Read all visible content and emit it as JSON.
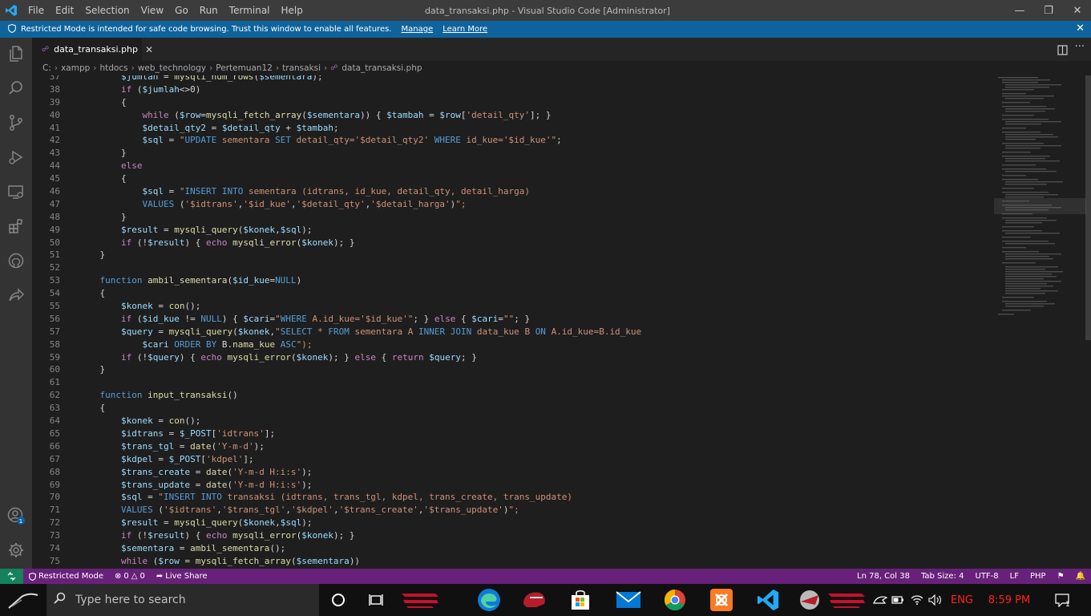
{
  "titlebar": {
    "menu": [
      "File",
      "Edit",
      "Selection",
      "View",
      "Go",
      "Run",
      "Terminal",
      "Help"
    ],
    "title": "data_transaksi.php - Visual Studio Code [Administrator]"
  },
  "banner": {
    "message": "Restricted Mode is intended for safe code browsing. Trust this window to enable all features.",
    "manage": "Manage",
    "learn_more": "Learn More"
  },
  "tab": {
    "label": "data_transaksi.php"
  },
  "breadcrumbs": [
    "C:",
    "xampp",
    "htdocs",
    "web_technology",
    "Pertemuan12",
    "transaksi",
    "data_transaksi.php"
  ],
  "code": {
    "lines": [
      {
        "n": "37",
        "t": "        $jumlah = mysqli_num_rows($sementara);"
      },
      {
        "n": "38",
        "t": "        if ($jumlah<>0)"
      },
      {
        "n": "39",
        "t": "        {"
      },
      {
        "n": "40",
        "t": "            while ($row=mysqli_fetch_array($sementara)) { $tambah = $row['detail_qty']; }"
      },
      {
        "n": "41",
        "t": "            $detail_qty2 = $detail_qty + $tambah;"
      },
      {
        "n": "42",
        "t": "            $sql = \"UPDATE sementara SET detail_qty='$detail_qty2' WHERE id_kue='$id_kue'\";"
      },
      {
        "n": "43",
        "t": "        }"
      },
      {
        "n": "44",
        "t": "        else"
      },
      {
        "n": "45",
        "t": "        {"
      },
      {
        "n": "46",
        "t": "            $sql = \"INSERT INTO sementara (idtrans, id_kue, detail_qty, detail_harga)"
      },
      {
        "n": "47",
        "t": "            VALUES ('$idtrans','$id_kue','$detail_qty','$detail_harga')\";"
      },
      {
        "n": "48",
        "t": "        }"
      },
      {
        "n": "49",
        "t": "        $result = mysqli_query($konek,$sql);"
      },
      {
        "n": "50",
        "t": "        if (!$result) { echo mysqli_error($konek); }"
      },
      {
        "n": "51",
        "t": "    }"
      },
      {
        "n": "52",
        "t": ""
      },
      {
        "n": "53",
        "t": "    function ambil_sementara($id_kue=NULL)"
      },
      {
        "n": "54",
        "t": "    {"
      },
      {
        "n": "55",
        "t": "        $konek = con();"
      },
      {
        "n": "56",
        "t": "        if ($id_kue != NULL) { $cari=\"WHERE A.id_kue='$id_kue'\"; } else { $cari=\"\"; }"
      },
      {
        "n": "57",
        "t": "        $query = mysqli_query($konek,\"SELECT * FROM sementara A INNER JOIN data_kue B ON A.id_kue=B.id_kue"
      },
      {
        "n": "58",
        "t": "            $cari ORDER BY B.nama_kue ASC\");"
      },
      {
        "n": "59",
        "t": "        if (!$query) { echo mysqli_error($konek); } else { return $query; }"
      },
      {
        "n": "60",
        "t": "    }"
      },
      {
        "n": "61",
        "t": ""
      },
      {
        "n": "62",
        "t": "    function input_transaksi()"
      },
      {
        "n": "63",
        "t": "    {"
      },
      {
        "n": "64",
        "t": "        $konek = con();"
      },
      {
        "n": "65",
        "t": "        $idtrans = $_POST['idtrans'];"
      },
      {
        "n": "66",
        "t": "        $trans_tgl = date('Y-m-d');"
      },
      {
        "n": "67",
        "t": "        $kdpel = $_POST['kdpel'];"
      },
      {
        "n": "68",
        "t": "        $trans_create = date('Y-m-d H:i:s');"
      },
      {
        "n": "69",
        "t": "        $trans_update = date('Y-m-d H:i:s');"
      },
      {
        "n": "70",
        "t": "        $sql = \"INSERT INTO transaksi (idtrans, trans_tgl, kdpel, trans_create, trans_update)"
      },
      {
        "n": "71",
        "t": "        VALUES ('$idtrans','$trans_tgl','$kdpel','$trans_create','$trans_update')\";"
      },
      {
        "n": "72",
        "t": "        $result = mysqli_query($konek,$sql);"
      },
      {
        "n": "73",
        "t": "        if (!$result) { echo mysqli_error($konek); }"
      },
      {
        "n": "74",
        "t": "        $sementara = ambil_sementara();"
      },
      {
        "n": "75",
        "t": "        while ($row = mysqli_fetch_array($sementara))"
      }
    ]
  },
  "statusbar": {
    "restricted": "Restricted Mode",
    "errors": "0",
    "warnings": "0",
    "live_share": "Live Share",
    "position": "Ln 78, Col 38",
    "tab_size": "Tab Size: 4",
    "encoding": "UTF-8",
    "eol": "LF",
    "language": "PHP"
  },
  "taskbar": {
    "search_placeholder": "Type here to search",
    "language": "ENG",
    "time": "8:59 PM",
    "notifications": "1"
  },
  "accounts_badge": "1",
  "colors": {
    "titlebar": "#3c3c3c",
    "banner": "#0e639c",
    "statusbar": "#68217a",
    "keyword": "#569cd6",
    "variable": "#9cdcfe",
    "function": "#dcdcaa",
    "string": "#ce9178",
    "control": "#c586c0"
  }
}
